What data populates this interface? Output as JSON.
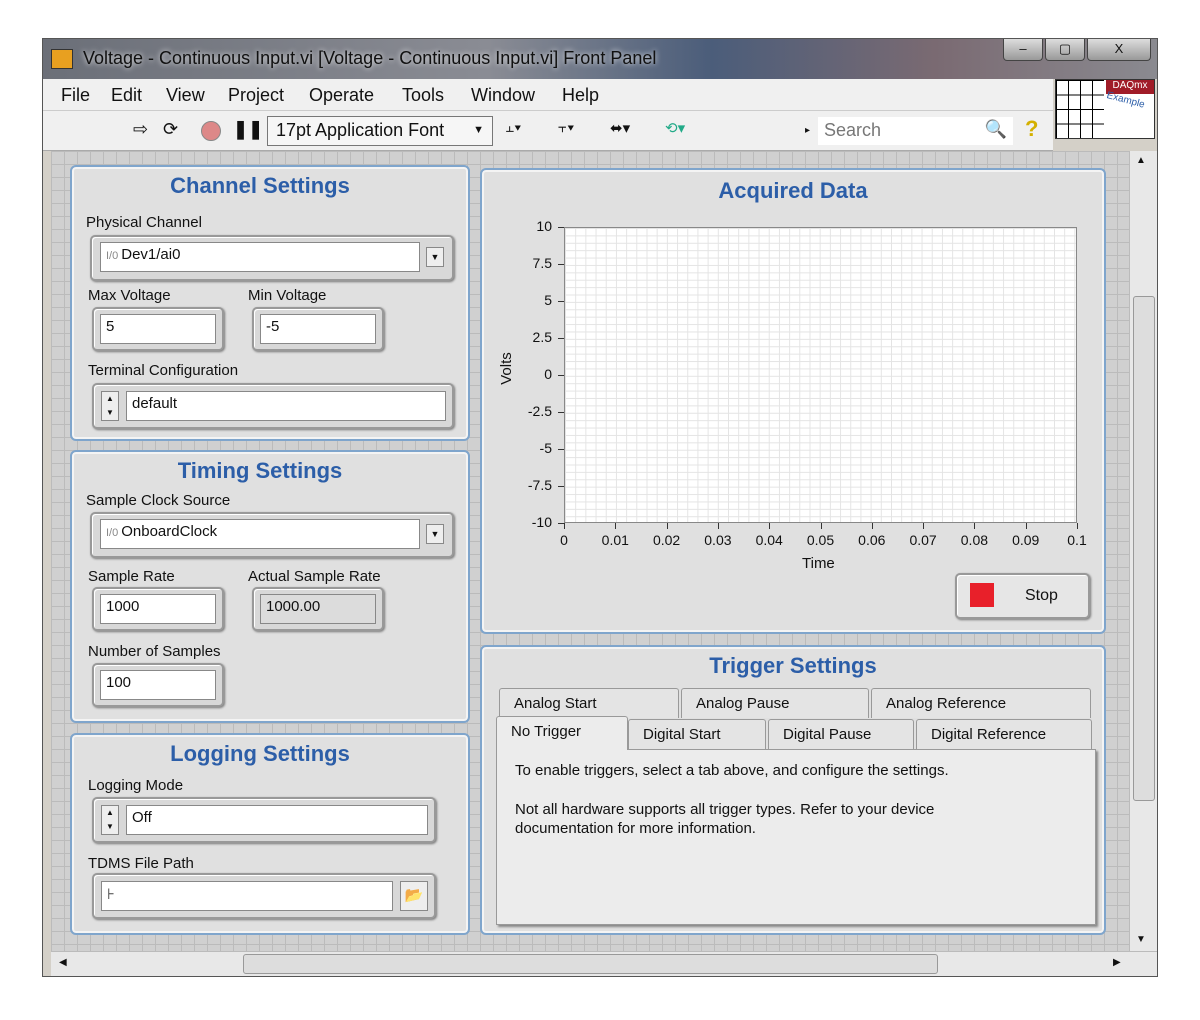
{
  "window": {
    "title": "Voltage - Continuous Input.vi [Voltage - Continuous Input.vi] Front Panel",
    "minimize": "‒",
    "maximize": "▢",
    "close": "X"
  },
  "menu": [
    "File",
    "Edit",
    "View",
    "Project",
    "Operate",
    "Tools",
    "Window",
    "Help"
  ],
  "toolbar": {
    "font": "17pt Application Font",
    "search_placeholder": "Search",
    "logo_top": "DAQmx",
    "logo_bottom": "Example"
  },
  "channel": {
    "title": "Channel Settings",
    "physical_channel_label": "Physical Channel",
    "physical_channel": "Dev1/ai0",
    "max_label": "Max Voltage",
    "max": "5",
    "min_label": "Min Voltage",
    "min": "-5",
    "terminal_label": "Terminal Configuration",
    "terminal": "default"
  },
  "timing": {
    "title": "Timing Settings",
    "clock_label": "Sample Clock Source",
    "clock": "OnboardClock",
    "rate_label": "Sample Rate",
    "rate": "1000",
    "actual_label": "Actual Sample Rate",
    "actual": "1000.00",
    "samples_label": "Number of Samples",
    "samples": "100"
  },
  "logging": {
    "title": "Logging Settings",
    "mode_label": "Logging Mode",
    "mode": "Off",
    "path_label": "TDMS File Path",
    "path": ""
  },
  "chart_data": {
    "type": "line",
    "title": "Acquired Data",
    "xlabel": "Time",
    "ylabel": "Volts",
    "xlim": [
      0,
      0.1
    ],
    "ylim": [
      -10,
      10
    ],
    "grid": true,
    "x_ticks": [
      "0",
      "0.01",
      "0.02",
      "0.03",
      "0.04",
      "0.05",
      "0.06",
      "0.07",
      "0.08",
      "0.09",
      "0.1"
    ],
    "y_ticks": [
      "10",
      "7.5",
      "5",
      "2.5",
      "0",
      "-2.5",
      "-5",
      "-7.5",
      "-10"
    ],
    "series": []
  },
  "stop_label": "Stop",
  "trigger": {
    "title": "Trigger Settings",
    "tabs_row1": [
      "Analog Start",
      "Analog Pause",
      "Analog Reference"
    ],
    "tabs_row2": [
      "No Trigger",
      "Digital Start",
      "Digital Pause",
      "Digital Reference"
    ],
    "text1": "To enable triggers, select a tab above, and configure the settings.",
    "text2": "Not all hardware supports all trigger types. Refer to your device documentation for more information."
  },
  "colors": {
    "accent": "#2c5ea8",
    "stop": "#e8202a"
  }
}
